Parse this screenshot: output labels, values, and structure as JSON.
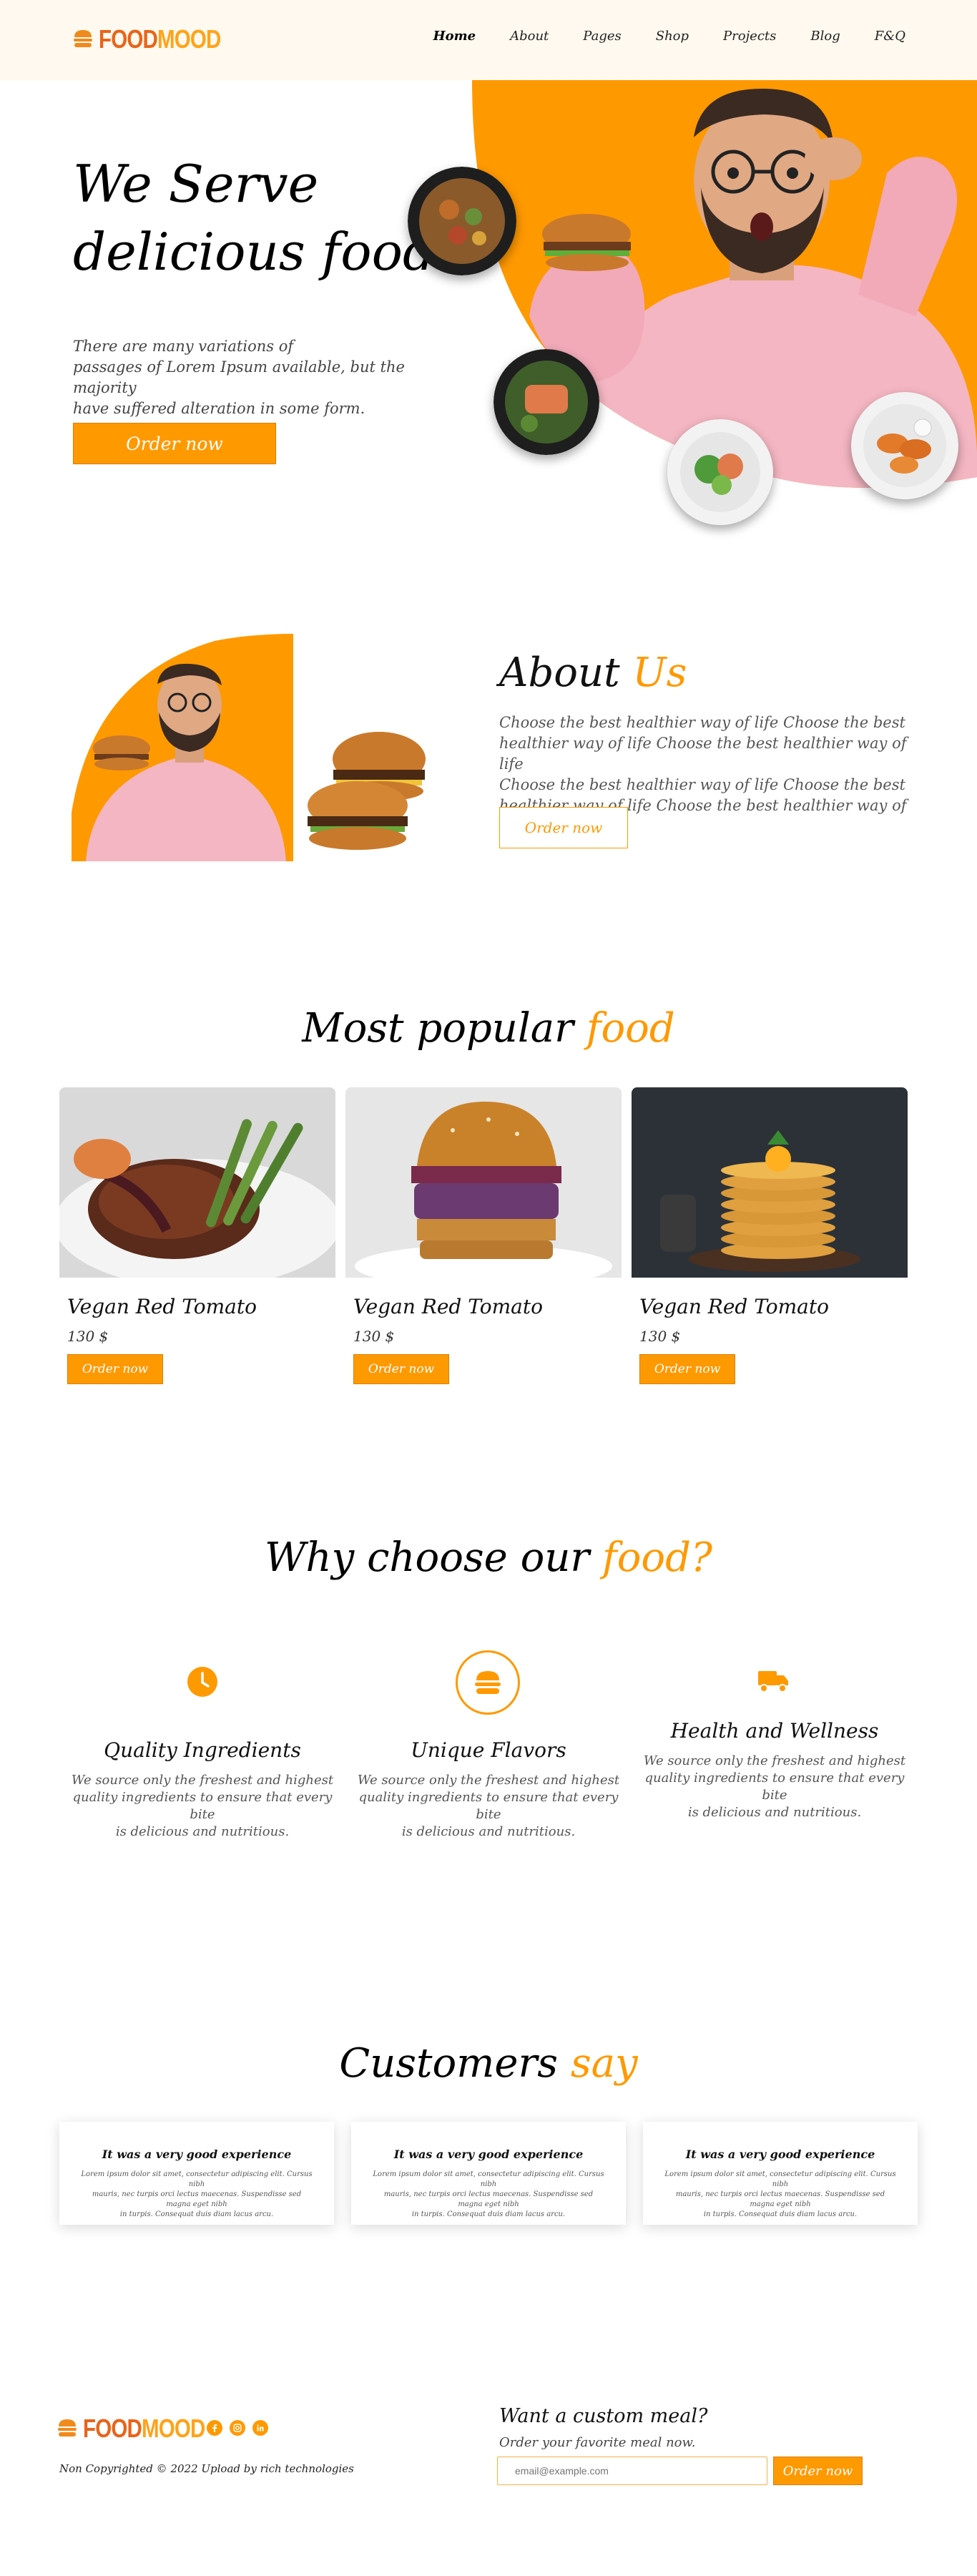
{
  "colors": {
    "accent": "#ff9900",
    "header_bg": "#fff9ef",
    "logo_food": "#e8641a",
    "logo_mood": "#ffa31a"
  },
  "header": {
    "logo_word_1": "FOOD",
    "logo_word_2": "MOOD",
    "logo_icon": "burger-icon",
    "nav": [
      "Home",
      "About",
      "Pages",
      "Shop",
      "Projects",
      "Blog",
      "F&Q"
    ]
  },
  "hero": {
    "title_line_1": "We Serve",
    "title_line_2": "delicious food",
    "desc_line_1": "There are many variations of",
    "desc_line_2": "passages of Lorem Ipsum available, but the majority",
    "desc_line_3": "have suffered alteration in some form.",
    "cta": "Order now"
  },
  "about": {
    "title_a": "About",
    "title_b": "Us",
    "lines": [
      "Choose the best healthier way of life Choose the best",
      "healthier way of life Choose the best healthier way of life",
      "Choose the best healthier way of life Choose the best",
      "healthier way of life Choose the best healthier way of life"
    ],
    "cta": "Order now"
  },
  "popular": {
    "title_a": "Most popular",
    "title_b": "food",
    "items": [
      {
        "name": "Vegan Red Tomato",
        "price": "130 $",
        "cta": "Order now"
      },
      {
        "name": "Vegan Red Tomato",
        "price": "130 $",
        "cta": "Order now"
      },
      {
        "name": "Vegan Red Tomato",
        "price": "130 $",
        "cta": "Order now"
      }
    ]
  },
  "why": {
    "title_a": "Why choose our",
    "title_b": "food?",
    "features": [
      {
        "icon": "clock-icon",
        "title": "Quality Ingredients",
        "l1": "We source only the freshest and highest",
        "l2": "quality ingredients to ensure that every bite",
        "l3": "is delicious and nutritious."
      },
      {
        "icon": "burger-icon",
        "title": "Unique Flavors",
        "l1": "We source only the freshest and highest",
        "l2": "quality ingredients to ensure that every bite",
        "l3": "is delicious and nutritious."
      },
      {
        "icon": "truck-icon",
        "title": "Health and Wellness",
        "l1": "We source only the freshest and highest",
        "l2": "quality ingredients to ensure that every bite",
        "l3": "is delicious and nutritious."
      }
    ]
  },
  "testimonials": {
    "title_a": "Customers",
    "title_b": "say",
    "items": [
      {
        "title": "It was a very good experience",
        "l1": "Lorem ipsum dolor sit amet, consectetur adipiscing elit. Cursus nibh",
        "l2": "mauris, nec turpis orci lectus maecenas. Suspendisse sed magna eget nibh",
        "l3": "in turpis. Consequat duis diam lacus arcu."
      },
      {
        "title": "It was a very good experience",
        "l1": "Lorem ipsum dolor sit amet, consectetur adipiscing elit. Cursus nibh",
        "l2": "mauris, nec turpis orci lectus maecenas. Suspendisse sed magna eget nibh",
        "l3": "in turpis. Consequat duis diam lacus arcu."
      },
      {
        "title": "It was a very good experience",
        "l1": "Lorem ipsum dolor sit amet, consectetur adipiscing elit. Cursus nibh",
        "l2": "mauris, nec turpis orci lectus maecenas. Suspendisse sed magna eget nibh",
        "l3": "in turpis. Consequat duis diam lacus arcu."
      }
    ]
  },
  "footer": {
    "logo_word_1": "FOOD",
    "logo_word_2": "MOOD",
    "socials": [
      "facebook-icon",
      "instagram-icon",
      "linkedin-icon"
    ],
    "copyright": "Non Copyrighted © 2022 Upload by rich technologies",
    "custom_title": "Want a custom meal?",
    "custom_sub": "Order your favorite meal now.",
    "email_placeholder": "email@example.com",
    "cta": "Order now"
  }
}
